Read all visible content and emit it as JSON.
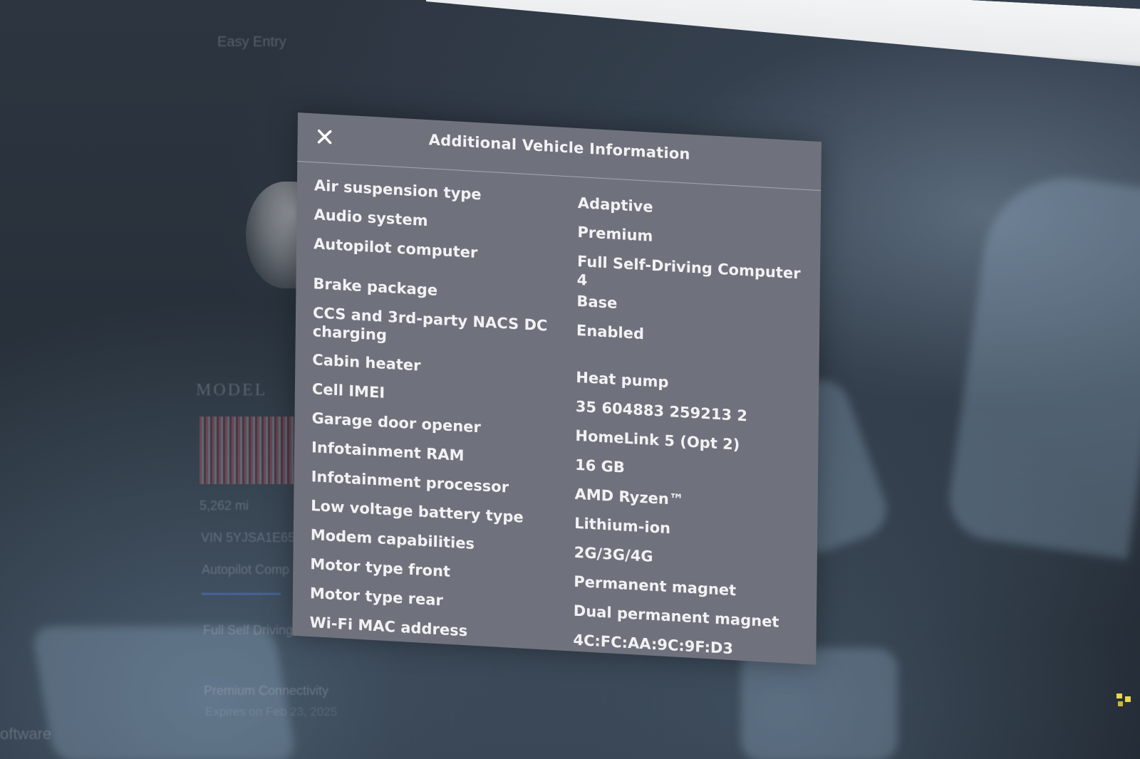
{
  "background": {
    "easy_entry_label": "Easy Entry",
    "model_label": "MODEL",
    "odometer": "5,262 mi",
    "vin_prefix": "VIN 5YJSA1E65",
    "autopilot_partial": "Autopilot Comp",
    "fsd_partial": "Full Self Driving",
    "connectivity_label": "Premium Connectivity",
    "connectivity_date": "Expires on Feb 23, 2025",
    "software_partial": "oftware"
  },
  "dialog": {
    "title": "Additional Vehicle Information",
    "close_icon": "close-icon",
    "rows": [
      {
        "label": "Air suspension type",
        "value": "Adaptive"
      },
      {
        "label": "Audio system",
        "value": "Premium"
      },
      {
        "label": "Autopilot computer",
        "value": "Full Self-Driving Computer 4"
      },
      {
        "label": "Brake package",
        "value": "Base"
      },
      {
        "label": "CCS and 3rd-party NACS DC charging",
        "value": "Enabled"
      },
      {
        "label": "Cabin heater",
        "value": "Heat pump"
      },
      {
        "label": "Cell IMEI",
        "value": "35 604883 259213 2"
      },
      {
        "label": "Garage door opener",
        "value": "HomeLink 5 (Opt 2)"
      },
      {
        "label": "Infotainment RAM",
        "value": "16 GB"
      },
      {
        "label": "Infotainment processor",
        "value": "AMD Ryzen™"
      },
      {
        "label": "Low voltage battery type",
        "value": "Lithium-ion"
      },
      {
        "label": "Modem capabilities",
        "value": "2G/3G/4G"
      },
      {
        "label": "Motor type front",
        "value": "Permanent magnet"
      },
      {
        "label": "Motor type rear",
        "value": "Dual permanent magnet"
      },
      {
        "label": "Wi-Fi MAC address",
        "value": "4C:FC:AA:9C:9F:D3"
      }
    ]
  },
  "colors": {
    "dialog_bg": "#6f727c",
    "text": "#f1f2f4",
    "screen_bg": "#273039"
  }
}
